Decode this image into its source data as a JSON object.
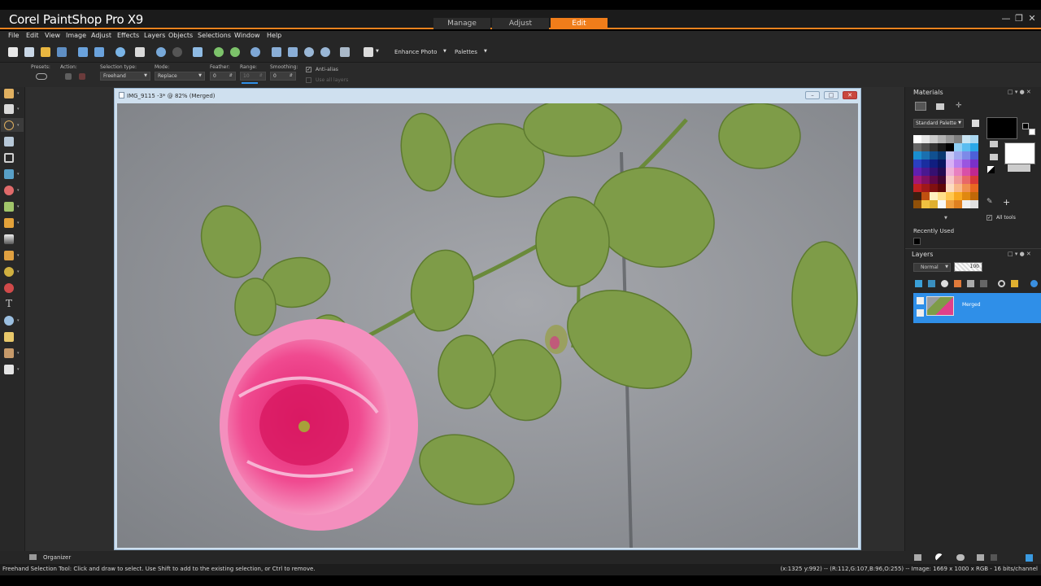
{
  "app": {
    "title": "Corel PaintShop Pro X9"
  },
  "workspace_tabs": [
    {
      "label": "Manage",
      "active": false
    },
    {
      "label": "Adjust",
      "active": false
    },
    {
      "label": "Edit",
      "active": true
    }
  ],
  "menu": [
    "File",
    "Edit",
    "View",
    "Image",
    "Adjust",
    "Effects",
    "Layers",
    "Objects",
    "Selections",
    "Window",
    "Help"
  ],
  "toolbar": {
    "enhance_photo": "Enhance Photo",
    "palettes": "Palettes"
  },
  "options": {
    "presets_label": "Presets:",
    "action_label": "Action:",
    "selection_type_label": "Selection type:",
    "selection_type_value": "Freehand",
    "mode_label": "Mode:",
    "mode_value": "Replace",
    "feather_label": "Feather:",
    "feather_value": "0",
    "range_label": "Range:",
    "range_value": "10",
    "smoothing_label": "Smoothing:",
    "smoothing_value": "0",
    "antialias_label": "Anti-alias",
    "use_all_layers_label": "Use all layers"
  },
  "image_window": {
    "title": "IMG_9115 -3* @  82% (Merged)"
  },
  "materials": {
    "title": "Materials",
    "palette_select": "Standard Palette",
    "all_tools_label": "All tools",
    "recently_used_label": "Recently Used"
  },
  "layers": {
    "title": "Layers",
    "blend_mode": "Normal",
    "opacity": "100",
    "layer_name": "Merged"
  },
  "bottom": {
    "organizer": "Organizer"
  },
  "status": {
    "hint": "Freehand Selection Tool: Click and draw to select. Use Shift to add to the existing selection, or Ctrl to remove.",
    "info": "(x:1325 y:992) -- (R:112,G:107,B:96,O:255) -- Image:  1669 x 1000 x RGB - 16 bits/channel"
  },
  "colors": {
    "accent": "#f07d1a",
    "layer_selected": "#2f8fe8",
    "foreground": "#000000",
    "background": "#ffffff"
  }
}
